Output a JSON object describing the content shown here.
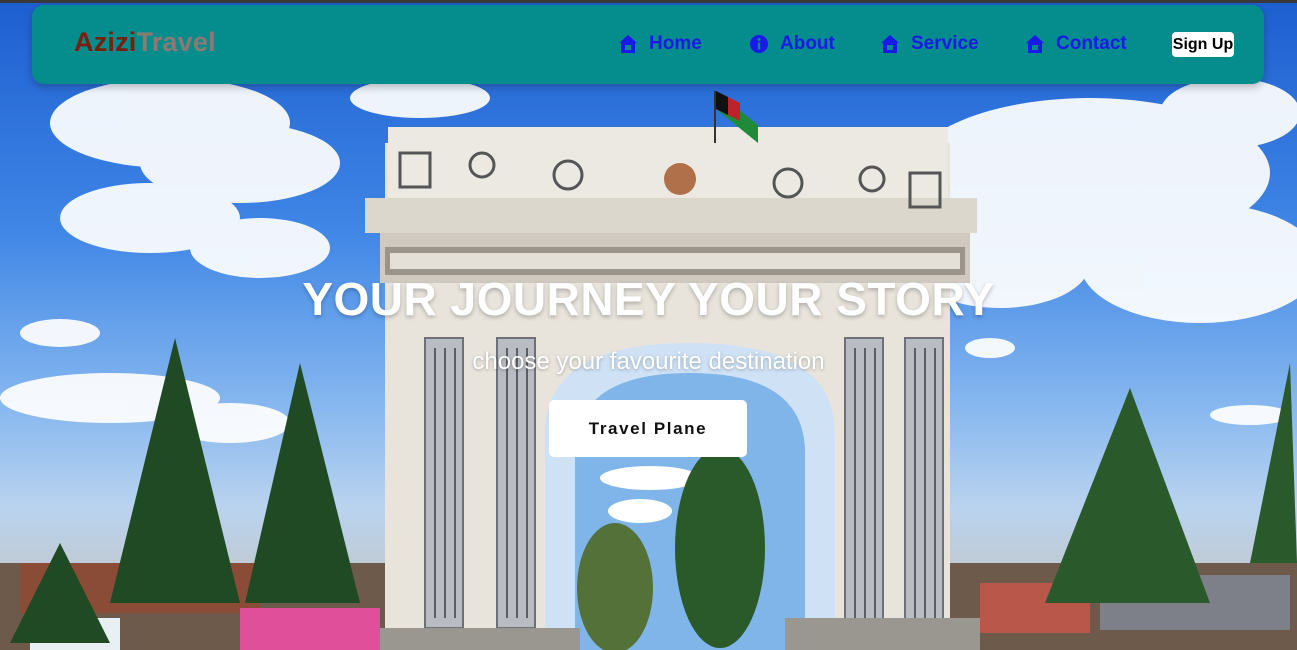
{
  "brand": {
    "part1": "Azizi",
    "part2": "Travel"
  },
  "nav": {
    "items": [
      {
        "label": "Home",
        "icon": "home-icon"
      },
      {
        "label": "About",
        "icon": "info-icon"
      },
      {
        "label": "Service",
        "icon": "home-icon"
      },
      {
        "label": "Contact",
        "icon": "home-icon"
      }
    ],
    "signup_label": "Sign Up"
  },
  "hero": {
    "title": "YOUR JOURNEY YOUR STORY",
    "subtitle": "choose your favourite destination",
    "cta_label": "Travel Plane"
  },
  "colors": {
    "navbar": "#058c8c",
    "nav_link": "#1a1ae6",
    "brand_dark": "#7a1f0e",
    "brand_light": "#8c7a72"
  }
}
